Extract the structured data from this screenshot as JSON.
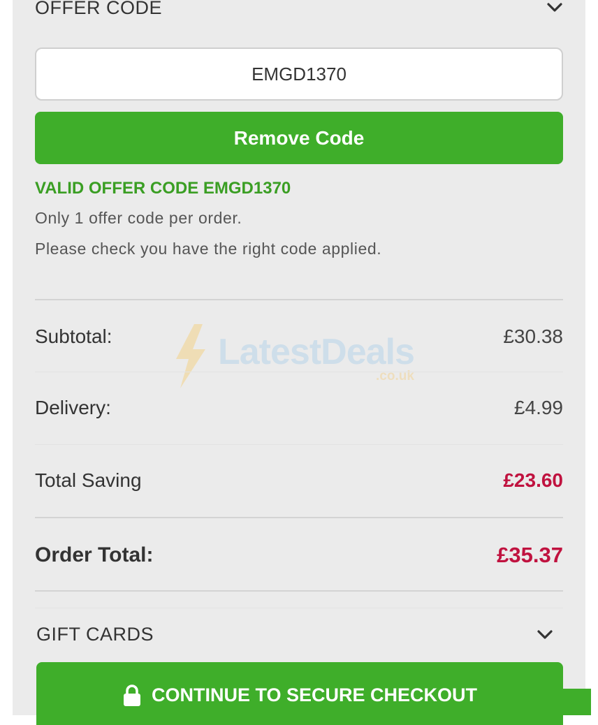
{
  "offer_code": {
    "title": "OFFER CODE",
    "toggle_icon": "chevron-down-icon",
    "input_value": "EMGD1370",
    "remove_label": "Remove Code",
    "valid_message": "VALID OFFER CODE EMGD1370",
    "note_1": "Only 1 offer code per order.",
    "note_2": "Please check you have the right code applied."
  },
  "summary": {
    "subtotal_label": "Subtotal:",
    "subtotal_value": "£30.38",
    "delivery_label": "Delivery:",
    "delivery_value": "£4.99",
    "saving_label": "Total Saving",
    "saving_value": "£23.60",
    "total_label": "Order Total:",
    "total_value": "£35.37"
  },
  "gift_cards": {
    "title": "GIFT CARDS",
    "toggle_icon": "chevron-down-icon"
  },
  "checkout": {
    "label": "CONTINUE TO SECURE CHECKOUT",
    "icon": "lock-icon"
  },
  "watermark": {
    "brand": "LatestDeals",
    "suffix": ".co.uk"
  },
  "colors": {
    "accent_green": "#3fae2a",
    "valid_green": "#3a9e23",
    "price_red": "#c0123f",
    "panel_bg": "#ebebeb"
  }
}
